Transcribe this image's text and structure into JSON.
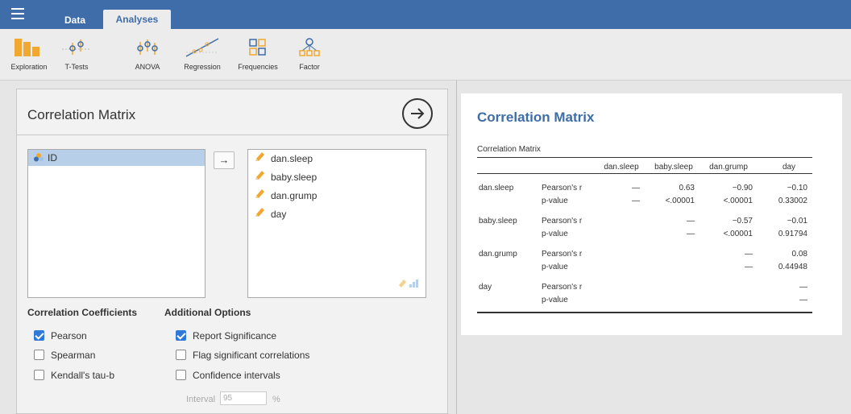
{
  "topbar": {
    "tabs": [
      {
        "label": "Data"
      },
      {
        "label": "Analyses"
      }
    ]
  },
  "ribbon": {
    "items": [
      {
        "label": "Exploration",
        "icon": "exploration-icon"
      },
      {
        "label": "T-Tests",
        "icon": "ttests-icon"
      },
      {
        "label": "ANOVA",
        "icon": "anova-icon"
      },
      {
        "label": "Regression",
        "icon": "regression-icon"
      },
      {
        "label": "Frequencies",
        "icon": "frequencies-icon"
      },
      {
        "label": "Factor",
        "icon": "factor-icon"
      }
    ]
  },
  "options": {
    "title": "Correlation Matrix",
    "source_vars": [
      {
        "name": "ID"
      }
    ],
    "move_arrow": "→",
    "selected_vars": [
      {
        "name": "dan.sleep"
      },
      {
        "name": "baby.sleep"
      },
      {
        "name": "dan.grump"
      },
      {
        "name": "day"
      }
    ],
    "coefficients": {
      "heading": "Correlation Coefficients",
      "items": [
        {
          "label": "Pearson",
          "checked": true
        },
        {
          "label": "Spearman",
          "checked": false
        },
        {
          "label": "Kendall's tau-b",
          "checked": false
        }
      ]
    },
    "additional": {
      "heading": "Additional Options",
      "items": [
        {
          "label": "Report Significance",
          "checked": true
        },
        {
          "label": "Flag significant correlations",
          "checked": false
        },
        {
          "label": "Confidence intervals",
          "checked": false
        }
      ]
    },
    "interval": {
      "label": "Interval",
      "value": "95",
      "unit": "%"
    }
  },
  "results": {
    "title": "Correlation Matrix",
    "table": {
      "caption": "Correlation Matrix",
      "columns": [
        "dan.sleep",
        "baby.sleep",
        "dan.grump",
        "day"
      ],
      "rows": [
        {
          "var": "dan.sleep",
          "r": [
            "—",
            "0.63",
            "−0.90",
            "−0.10"
          ],
          "p": [
            "—",
            "<.00001",
            "<.00001",
            "0.33002"
          ]
        },
        {
          "var": "baby.sleep",
          "r": [
            "",
            "—",
            "−0.57",
            "−0.01"
          ],
          "p": [
            "",
            "—",
            "<.00001",
            "0.91794"
          ]
        },
        {
          "var": "dan.grump",
          "r": [
            "",
            "",
            "—",
            "0.08"
          ],
          "p": [
            "",
            "",
            "—",
            "0.44948"
          ]
        },
        {
          "var": "day",
          "r": [
            "",
            "",
            "",
            "—"
          ],
          "p": [
            "",
            "",
            "",
            "—"
          ]
        }
      ],
      "stat_labels": {
        "r": "Pearson's r",
        "p": "p-value"
      }
    }
  },
  "colors": {
    "topbar": "#3e6da9",
    "accent": "#2f7ad8",
    "selection": "#b8cfea",
    "ribbon_icon": "#f0a830"
  }
}
